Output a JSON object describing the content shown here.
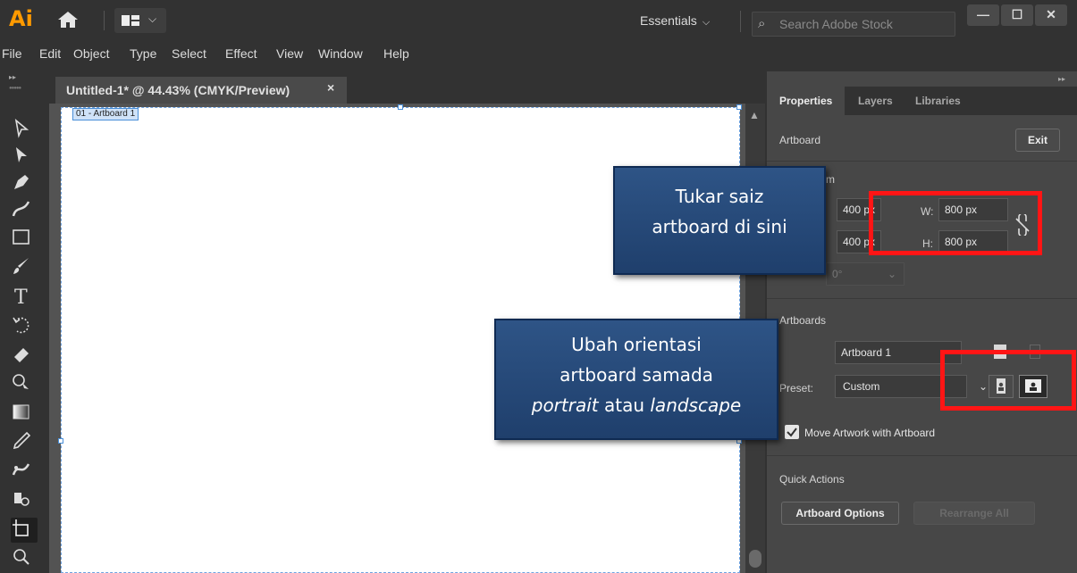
{
  "app": {
    "logo": "Ai",
    "workspace": "Essentials",
    "search_placeholder": "Search Adobe Stock",
    "window_buttons": {
      "minimize": "—",
      "maximize": "☐",
      "close": "✕"
    }
  },
  "menu": [
    "File",
    "Edit",
    "Object",
    "Type",
    "Select",
    "Effect",
    "View",
    "Window",
    "Help"
  ],
  "toolbar": {
    "tools": [
      "selection-tool",
      "direct-selection-tool",
      "pen-tool",
      "curvature-tool",
      "rectangle-tool",
      "paintbrush-tool",
      "type-tool",
      "rotate-tool",
      "eraser-tool",
      "shape-builder-tool",
      "gradient-tool",
      "eyedropper-tool",
      "blend-tool",
      "symbol-sprayer-tool",
      "artboard-tool",
      "zoom-tool"
    ],
    "active_tool": "artboard-tool"
  },
  "document": {
    "tab_title": "Untitled-1* @ 44.43% (CMYK/Preview)",
    "close_glyph": "×",
    "artboard_label": "01 - Artboard 1"
  },
  "panel": {
    "tabs": [
      "Properties",
      "Layers",
      "Libraries"
    ],
    "active_tab": "Properties",
    "section_artboard": "Artboard",
    "exit_label": "Exit",
    "transform_title_partial": "m",
    "x_value": "400 px",
    "y_value": "400 px",
    "w_label": "W:",
    "w_value": "800 px",
    "h_label": "H:",
    "h_value": "800 px",
    "rotate_value": "0°",
    "artboards_title": "Artboards",
    "artboard_name": "Artboard 1",
    "preset_label": "Preset:",
    "preset_value": "Custom",
    "move_artwork_label": "Move Artwork with Artboard",
    "move_artwork_checked": true,
    "quick_actions_title": "Quick Actions",
    "artboard_options_label": "Artboard Options",
    "rearrange_all_label": "Rearrange All"
  },
  "callouts": {
    "size": {
      "line1": "Tukar saiz",
      "line2": "artboard di sini"
    },
    "orientation": {
      "line1": "Ubah orientasi",
      "line2": "artboard samada",
      "line3_italic_a": "portrait",
      "line3_mid": " atau ",
      "line3_italic_b": "landscape"
    }
  },
  "colors": {
    "accent_logo": "#ff9a00",
    "callout_fill": "#2e5486",
    "highlight_box": "#ff1515"
  }
}
